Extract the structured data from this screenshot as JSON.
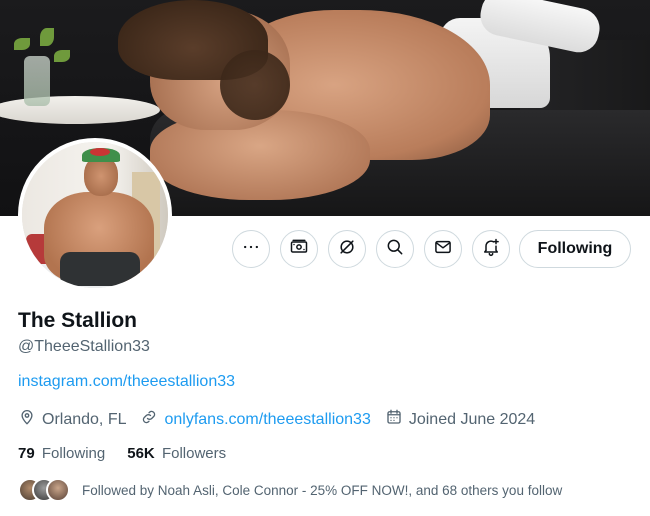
{
  "banner": {
    "alt": "Profile banner photo"
  },
  "avatar": {
    "alt": "Profile picture"
  },
  "actions": {
    "more_icon": "more-horizontal-icon",
    "subscribe_icon": "money-icon",
    "grok_icon": "grok-icon",
    "search_icon": "search-icon",
    "message_icon": "envelope-icon",
    "notify_icon": "bell-plus-icon",
    "following_label": "Following"
  },
  "profile": {
    "name": "The Stallion",
    "handle": "@TheeeStallion33",
    "bio_link": "instagram.com/theeestallion33",
    "location": "Orlando, FL",
    "website": "onlyfans.com/theeestallion33",
    "joined": "Joined June 2024"
  },
  "stats": {
    "following_count": "79",
    "following_label": "Following",
    "followers_count": "56K",
    "followers_label": "Followers"
  },
  "followed_by": {
    "text": "Followed by Noah Asli, Cole Connor - 25% OFF NOW!, and 68 others you follow"
  },
  "colors": {
    "text_primary": "#0f1419",
    "text_secondary": "#536471",
    "link": "#1d9bf0",
    "border": "#cfd9de"
  }
}
